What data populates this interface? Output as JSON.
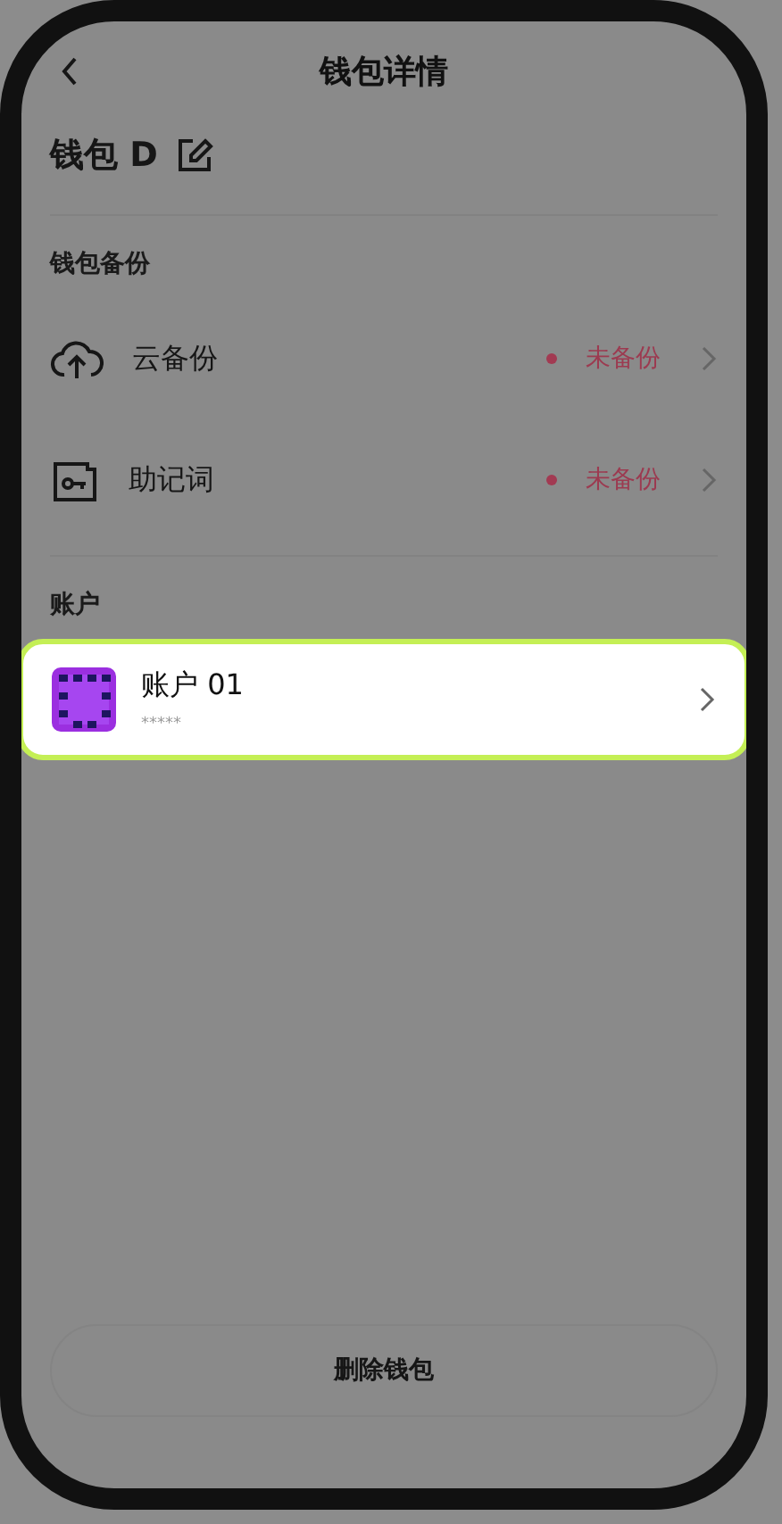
{
  "header": {
    "title": "钱包详情"
  },
  "wallet": {
    "name": "钱包 D"
  },
  "backup_section": {
    "title": "钱包备份",
    "items": [
      {
        "kind": "cloud",
        "label": "云备份",
        "status": "未备份"
      },
      {
        "kind": "mnemonic",
        "label": "助记词",
        "status": "未备份"
      }
    ]
  },
  "accounts_section": {
    "title": "账户",
    "items": [
      {
        "name": "账户 01",
        "balance": "*****",
        "selected": true
      }
    ]
  },
  "delete_button": "删除钱包"
}
